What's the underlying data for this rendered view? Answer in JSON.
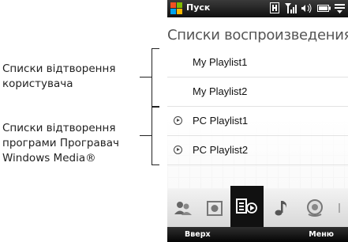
{
  "annotations": {
    "user_playlists": [
      "Списки відтворення",
      "користувача"
    ],
    "wmp_playlists": [
      "Списки відтворення",
      "програми Програвач",
      "Windows Media®"
    ]
  },
  "status_bar": {
    "start_label": "Пуск",
    "icons": [
      "sim-icon",
      "signal-icon",
      "speaker-icon",
      "battery-icon",
      "connectivity-icon"
    ]
  },
  "screen": {
    "title": "Списки воспроизведения",
    "playlists": [
      {
        "label": "My Playlist1",
        "icon": ""
      },
      {
        "label": "My Playlist2",
        "icon": ""
      },
      {
        "label": "PC Playlist1",
        "icon": "play-circle-icon"
      },
      {
        "label": "PC Playlist2",
        "icon": "play-circle-icon"
      }
    ]
  },
  "tabs": [
    {
      "name": "artists-icon",
      "active": false
    },
    {
      "name": "albums-icon",
      "active": false
    },
    {
      "name": "playlists-icon",
      "active": true
    },
    {
      "name": "music-note-icon",
      "active": false
    },
    {
      "name": "genres-icon",
      "active": false
    }
  ],
  "softkeys": {
    "left": "Вверх",
    "right": "Меню"
  }
}
